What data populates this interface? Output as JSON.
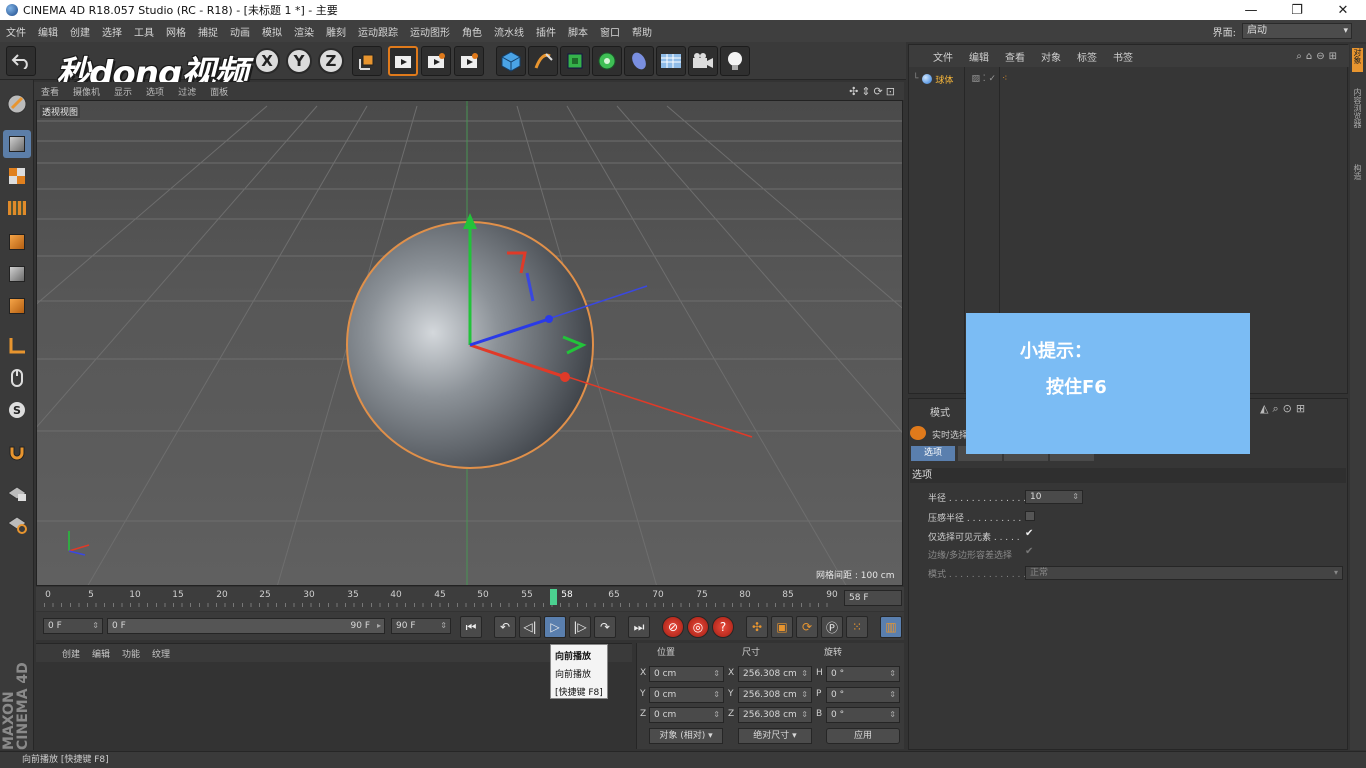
{
  "window": {
    "title": "CINEMA 4D R18.057 Studio (RC - R18) - [未标题 1 *] - 主要",
    "minimize": "—",
    "maximize": "❐",
    "close": "✕"
  },
  "menu": [
    "文件",
    "编辑",
    "创建",
    "选择",
    "工具",
    "网格",
    "捕捉",
    "动画",
    "模拟",
    "渲染",
    "雕刻",
    "运动跟踪",
    "运动图形",
    "角色",
    "流水线",
    "插件",
    "脚本",
    "窗口",
    "帮助"
  ],
  "layout": {
    "label": "界面:",
    "value": "启动"
  },
  "watermark": "秒dong视频",
  "toolbar": {
    "x": "X",
    "y": "Y",
    "z": "Z"
  },
  "viewport": {
    "menu": [
      "查看",
      "摄像机",
      "显示",
      "选项",
      "过滤",
      "面板"
    ],
    "nav_icons": "✣⇕⟳⊡",
    "label": "透视视图",
    "grid_spacing": "网格间距 : 100 cm"
  },
  "timeline": {
    "ticks": [
      "0",
      "5",
      "10",
      "15",
      "20",
      "25",
      "30",
      "35",
      "40",
      "45",
      "50",
      "55",
      "60",
      "65",
      "70",
      "75",
      "80",
      "85",
      "90"
    ],
    "current_marker": "58",
    "current_frame": "58 F",
    "start": "0 F",
    "range_start": "0 F",
    "range_end": "90 F",
    "end": "90 F"
  },
  "tooltip": {
    "title": "向前播放",
    "desc": "向前播放",
    "shortcut": "[快捷键 F8]"
  },
  "material_manager": {
    "menu": [
      "创建",
      "编辑",
      "功能",
      "纹理"
    ]
  },
  "coordinates": {
    "headers": {
      "position": "位置",
      "size": "尺寸",
      "rotation": "旋转"
    },
    "rows": [
      {
        "axis": "X",
        "pos": "0 cm",
        "size_axis": "X",
        "size": "256.308 cm",
        "rot_axis": "H",
        "rot": "0 °"
      },
      {
        "axis": "Y",
        "pos": "0 cm",
        "size_axis": "Y",
        "size": "256.308 cm",
        "rot_axis": "P",
        "rot": "0 °"
      },
      {
        "axis": "Z",
        "pos": "0 cm",
        "size_axis": "Z",
        "size": "256.308 cm",
        "rot_axis": "B",
        "rot": "0 °"
      }
    ],
    "mode": "对象 (相对)",
    "size_mode": "绝对尺寸",
    "apply": "应用"
  },
  "status": "向前播放 [快捷键 F8]",
  "object_manager": {
    "menu": [
      "文件",
      "编辑",
      "查看",
      "对象",
      "标签",
      "书签"
    ],
    "object_name": "球体"
  },
  "attribute_manager": {
    "mode": "模式",
    "live": "实时选择",
    "tab_selected": "选项",
    "section": "选项",
    "radius_label": "半径 . . . . . . . . . . . . . .",
    "radius_value": "10",
    "pressure_label": "压感半径 . . . . . . . . . .",
    "visible_only_label": "仅选择可见元素 . . . . .",
    "visible_only_check": "✔",
    "edge_label": "边缘/多边形容差选择",
    "edge_check": "✔",
    "mode_label": "模式 . . . . . . . . . . . . . .",
    "mode_value": "正常"
  },
  "right_strip": [
    "对象",
    "内容浏览器",
    "构造"
  ],
  "tip": {
    "line1": "小提示：",
    "line2": "按住F6"
  }
}
